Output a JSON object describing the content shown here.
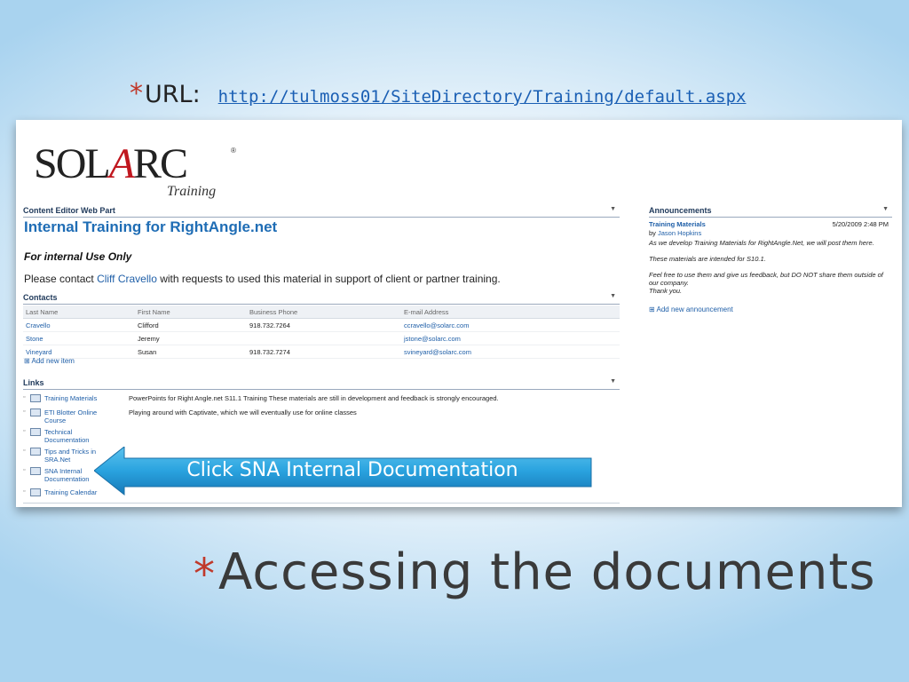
{
  "url_line": {
    "label": "URL:",
    "link": "http://tulmoss01/SiteDirectory/Training/default.aspx"
  },
  "logo": {
    "brand": "SOLARC",
    "brand_pre": "SOL",
    "brand_a": "A",
    "brand_post": "RC",
    "sub": "Training",
    "reg": "®"
  },
  "cewp": {
    "header": "Content Editor Web Part",
    "title": "Internal Training for RightAngle.net",
    "internal": "For internal Use Only",
    "line_pre": "Please contact ",
    "line_link": "Cliff Cravello",
    "line_post": " with requests to used this material in support of client or partner training."
  },
  "contacts": {
    "header": "Contacts",
    "columns": [
      "Last Name",
      "First Name",
      "Business Phone",
      "E-mail Address"
    ],
    "rows": [
      [
        "Cravello",
        "Clifford",
        "918.732.7264",
        "ccravello@solarc.com"
      ],
      [
        "Stone",
        "Jeremy",
        "",
        "jstone@solarc.com"
      ],
      [
        "Vineyard",
        "Susan",
        "918.732.7274",
        "svineyard@solarc.com"
      ]
    ],
    "add_label": "Add new item"
  },
  "links": {
    "header": "Links",
    "items": [
      {
        "title": "Training Materials",
        "desc": "PowerPoints for Right Angle.net S11.1 Training  These materials are still in development and feedback is strongly encouraged."
      },
      {
        "title": "ETI Blotter Online Course",
        "desc": "Playing around with Captivate, which we will eventually use for online classes"
      },
      {
        "title": "Technical Documentation",
        "desc": ""
      },
      {
        "title": "Tips and Tricks in SRA.Net",
        "desc": ""
      },
      {
        "title": "SNA Internal Documentation",
        "desc": ""
      },
      {
        "title": "Training Calendar",
        "desc": ""
      }
    ]
  },
  "announcements": {
    "header": "Announcements",
    "item_title": "Training Materials",
    "date": "5/20/2009 2:48 PM",
    "by_pre": "by ",
    "by_name": "Jason Hopkins",
    "body1": "As we develop Training Materials for RightAngle.Net, we will post them here.",
    "body2": "These materials are intended for S10.1.",
    "body3": "Feel free to use them and give us feedback, but DO NOT share them outside of our company.",
    "body4": "Thank you.",
    "add_label": "Add new announcement"
  },
  "callout": {
    "text": "Click SNA Internal Documentation"
  },
  "slide": {
    "title": "Accessing the documents",
    "bullet": "*"
  },
  "colors": {
    "accent": "#1f6db5",
    "callout": "#2aa3df",
    "bullet": "#c0392b"
  }
}
